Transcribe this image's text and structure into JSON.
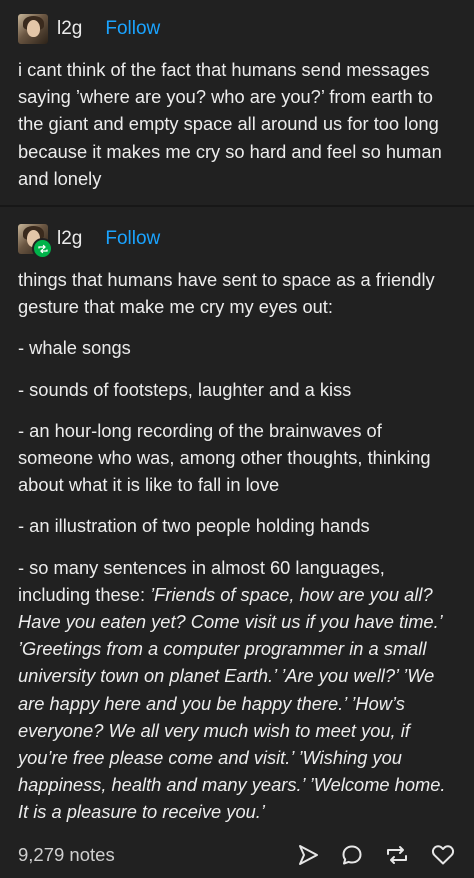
{
  "post1": {
    "username": "l2g",
    "follow_label": "Follow",
    "body": "i cant think of the fact that humans send messages saying ’where are you? who are you?’ from earth to the giant and empty space all around us for too long because it makes me cry so hard and feel so human and lonely"
  },
  "post2": {
    "username": "l2g",
    "follow_label": "Follow",
    "intro": "things that humans have sent to space as a friendly gesture that make me cry my eyes out:",
    "items": [
      "- whale songs",
      "- sounds of footsteps, laughter and a kiss",
      "- an hour-long recording of the brainwaves of someone who was, among other thoughts, thinking about what it is like to fall in love",
      "- an illustration of two people holding hands"
    ],
    "last_item_prefix": "- so many sentences in almost 60 languages, including these: ",
    "last_item_quotes": "’Friends of space, how are you all? Have you eaten yet? Come visit us if you have time.’ ’Greetings from a computer programmer in a small university town on planet Earth.’ ’Are you well?’ ’We are happy here and you be happy there.’ ’How’s everyone? We all very much wish to meet you, if you’re free please come and visit.’  ’Wishing you happiness, health and many years.’ ’Welcome home. It is a pleasure to receive you.’"
  },
  "footer": {
    "notes": "9,279 notes",
    "icons": [
      "share-icon",
      "reply-icon",
      "reblog-icon",
      "like-icon"
    ]
  },
  "colors": {
    "background": "#212121",
    "text": "#ececec",
    "follow": "#1aa3ff",
    "reblog_badge": "#00b34a"
  }
}
